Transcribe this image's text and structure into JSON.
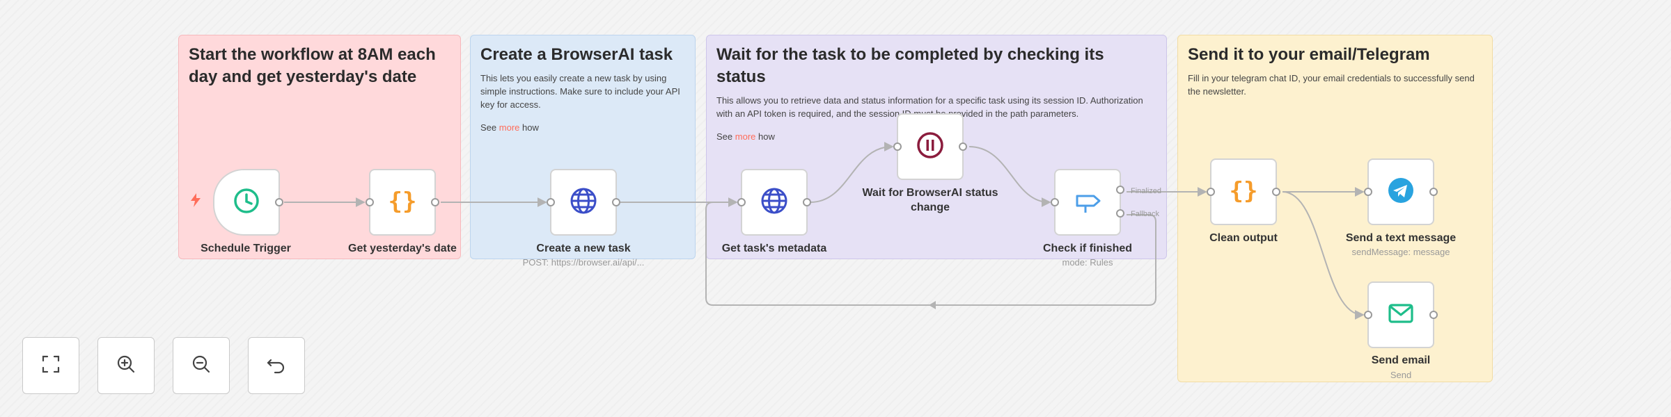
{
  "colors": {
    "accent": "#ff6d5a",
    "wire": "#b3b3b3",
    "trigger_icon": "#1ebd8a",
    "code_icon": "#f59c2b",
    "http_icon": "#3b4ec8",
    "wait_icon": "#8b1c3d",
    "switch_icon": "#4c9ee8",
    "telegram_icon": "#29a3df",
    "email_icon": "#1ebd8a"
  },
  "stickies": [
    {
      "title": "Start the workflow at 8AM each day and get yesterday's date"
    },
    {
      "title": "Create a BrowserAI task",
      "description": "This lets you easily create a new task by using simple instructions. Make sure to include your API key for access.",
      "see_prefix": "See",
      "see_link": "more",
      "see_suffix": "how"
    },
    {
      "title": "Wait for the task to be completed by checking its status",
      "description": "This allows you to retrieve data and status information for a specific task using its session ID. Authorization with an API token is required, and the session ID must be provided in the path parameters.",
      "see_prefix": "See",
      "see_link": "more",
      "see_suffix": "how"
    },
    {
      "title": "Send it to your email/Telegram",
      "description": "Fill in your telegram chat ID, your email credentials to successfully send the newsletter."
    }
  ],
  "nodes": {
    "schedule_trigger": {
      "label": "Schedule Trigger",
      "icon": "clock-icon"
    },
    "get_yesterday_date": {
      "label": "Get yesterday's date",
      "icon": "code-braces-icon"
    },
    "create_task": {
      "label": "Create a new task",
      "subtitle": "POST: https://browser.ai/api/...",
      "icon": "globe-icon"
    },
    "get_metadata": {
      "label": "Get task's metadata",
      "icon": "globe-icon"
    },
    "wait_status": {
      "label": "Wait for BrowserAI status change",
      "icon": "pause-icon"
    },
    "check_finished": {
      "label": "Check if finished",
      "subtitle": "mode: Rules",
      "icon": "signpost-icon",
      "outputs": [
        "Finalized",
        "Fallback"
      ]
    },
    "clean_output": {
      "label": "Clean output",
      "icon": "code-braces-icon"
    },
    "send_telegram": {
      "label": "Send a text message",
      "subtitle": "sendMessage: message",
      "icon": "telegram-icon"
    },
    "send_email": {
      "label": "Send email",
      "subtitle": "Send",
      "icon": "envelope-icon"
    }
  },
  "controls": [
    {
      "name": "fit-view",
      "icon": "fit-view-icon"
    },
    {
      "name": "zoom-in",
      "icon": "zoom-in-icon"
    },
    {
      "name": "zoom-out",
      "icon": "zoom-out-icon"
    },
    {
      "name": "reset",
      "icon": "undo-icon"
    }
  ]
}
